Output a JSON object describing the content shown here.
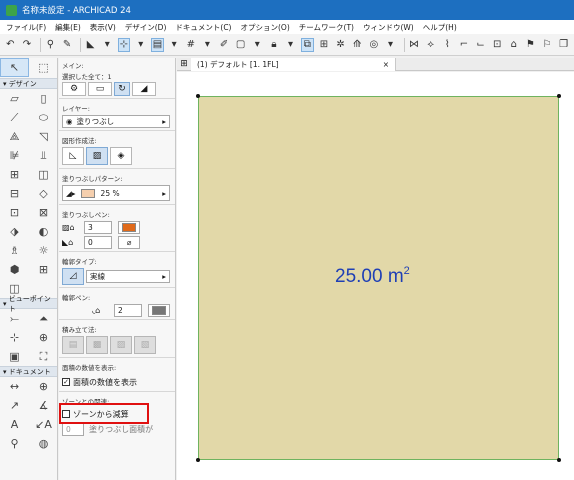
{
  "window": {
    "title": "名称未設定 - ARCHICAD 24"
  },
  "menu": [
    "ファイル(F)",
    "編集(E)",
    "表示(V)",
    "デザイン(D)",
    "ドキュメント(C)",
    "オプション(O)",
    "チームワーク(T)",
    "ウィンドウ(W)",
    "ヘルプ(H)"
  ],
  "toolbox": {
    "design_header": "デザイン",
    "viewpoint_header": "ビューポイント",
    "document_header": "ドキュメント"
  },
  "info": {
    "main_label": "メイン:",
    "selected_label": "選択した全て：1",
    "layer_label": "レイヤー:",
    "layer_value": "塗りつぶし",
    "shape_label": "図形作成法:",
    "pattern_label": "塗りつぶしパターン:",
    "pattern_percent": "25 %",
    "pen_label": "塗りつぶしペン:",
    "pen_value_1": "3",
    "pen_value_2": "0",
    "outline_type_label": "輪郭タイプ:",
    "outline_type_value": "実線",
    "outline_pen_label": "輪郭ペン:",
    "outline_pen_value": "2",
    "stack_order_label": "積み立て法:",
    "area_display_label": "面積の数値を表示:",
    "area_display_checkbox": "面積の数値を表示",
    "area_display_checked": true,
    "zone_label": "ゾーンとの関連:",
    "zone_checkbox": "ゾーンから減算",
    "zone_count": "0",
    "zone_field_placeholder": "塗りつぶし面積が"
  },
  "tab": {
    "title": "(1) デフォルト [1. 1FL]",
    "close": "×"
  },
  "canvas": {
    "area_value": "25.00 m",
    "area_unit_exp": "2"
  },
  "colors": {
    "title_bar": "#1d6fc0",
    "fill": "#e2d8a8",
    "outline": "#6fb35f",
    "area_text": "#1f3fb5",
    "highlight": "#e01010"
  }
}
